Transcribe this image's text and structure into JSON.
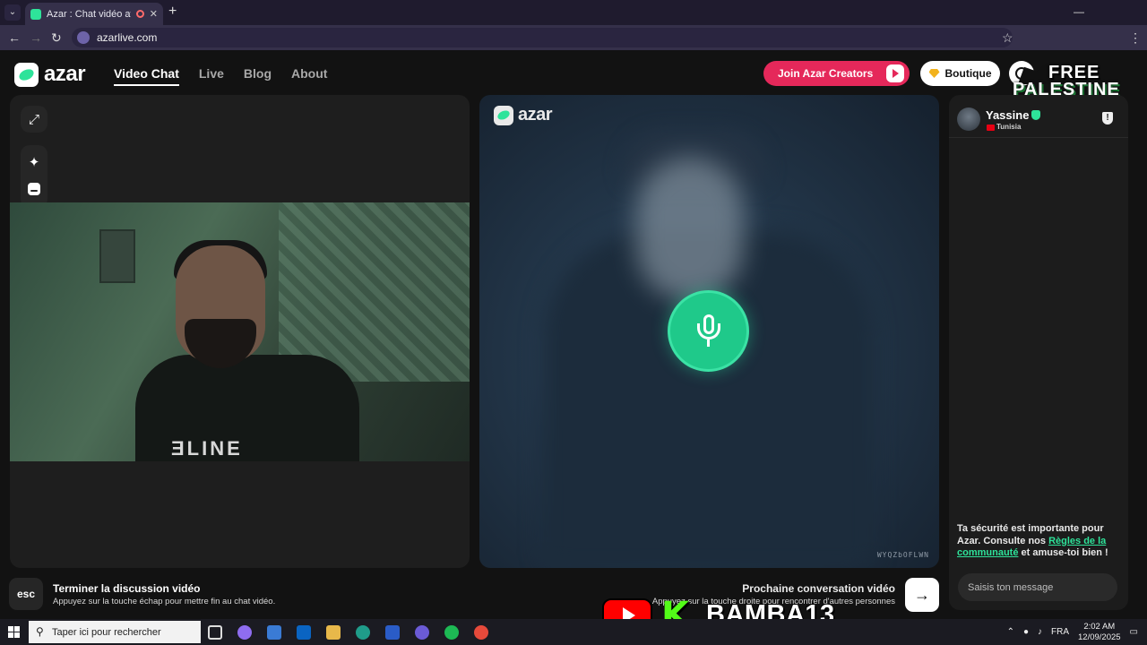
{
  "browser": {
    "tab_title": "Azar : Chat vidéo avec de n",
    "url": "azarlive.com"
  },
  "header": {
    "logo_text": "azar",
    "nav": [
      "Video Chat",
      "Live",
      "Blog",
      "About"
    ],
    "creators_button": "Join Azar Creators",
    "boutique_button": "Boutique"
  },
  "overlay": {
    "free": "FREE",
    "palestine": "PALESTINE",
    "streamer": "BAMBA13",
    "kick_letter": "K"
  },
  "self_video": {
    "shirt_text": "ƎLINE"
  },
  "partner_video": {
    "logo_text": "azar",
    "watermark": "WYQZbOFLWN"
  },
  "chat": {
    "partner_name": "Yassine",
    "partner_country": "Tunisia",
    "safety_prefix": "Ta sécurité est importante pour Azar. Consulte nos ",
    "safety_link": "Règles de la communauté",
    "safety_suffix": " et amuse-toi bien !",
    "input_placeholder": "Saisis ton message"
  },
  "footer": {
    "esc_key": "esc",
    "end_title": "Terminer la discussion vidéo",
    "end_desc": "Appuyez sur la touche échap pour mettre fin au chat vidéo.",
    "next_title": "Prochaine conversation vidéo",
    "next_desc": "Appuyez sur la touche droite pour rencontrer d'autres personnes"
  },
  "taskbar": {
    "search_placeholder": "Taper ici pour rechercher",
    "language": "FRA",
    "time": "2:02 AM",
    "date": "12/09/2025"
  },
  "colors": {
    "brand_green": "#2ee39a",
    "creators_pink": "#e5285a",
    "mic_green": "#1fc98a"
  }
}
